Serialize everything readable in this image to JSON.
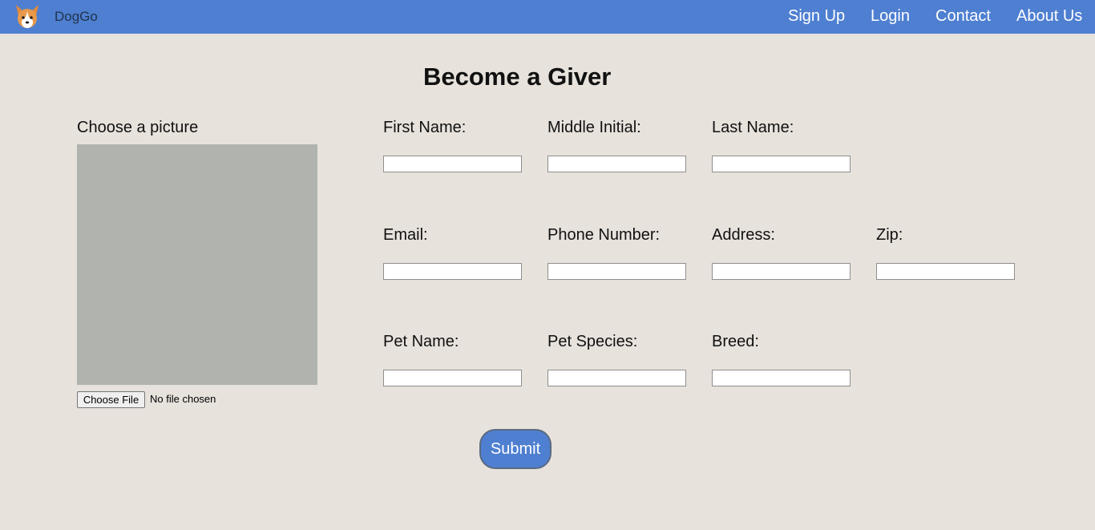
{
  "navbar": {
    "brand": "DogGo",
    "logo_icon": "corgi-logo-icon",
    "links": [
      {
        "label": "Sign Up"
      },
      {
        "label": "Login"
      },
      {
        "label": "Contact"
      },
      {
        "label": "About Us"
      }
    ]
  },
  "page": {
    "title": "Become a Giver"
  },
  "picture": {
    "label": "Choose a picture",
    "file_button": "Choose File",
    "file_status": "No file chosen"
  },
  "form": {
    "first_name": {
      "label": "First Name:",
      "value": ""
    },
    "middle_initial": {
      "label": "Middle Initial:",
      "value": ""
    },
    "last_name": {
      "label": "Last Name:",
      "value": ""
    },
    "email": {
      "label": "Email:",
      "value": ""
    },
    "phone": {
      "label": "Phone Number:",
      "value": ""
    },
    "address": {
      "label": "Address:",
      "value": ""
    },
    "zip": {
      "label": "Zip:",
      "value": ""
    },
    "pet_name": {
      "label": "Pet Name:",
      "value": ""
    },
    "pet_species": {
      "label": "Pet Species:",
      "value": ""
    },
    "breed": {
      "label": "Breed:",
      "value": ""
    },
    "submit_label": "Submit"
  },
  "colors": {
    "navbar": "#4e7fd1",
    "background": "#e7e2dc",
    "submit": "#4e7fd1"
  }
}
